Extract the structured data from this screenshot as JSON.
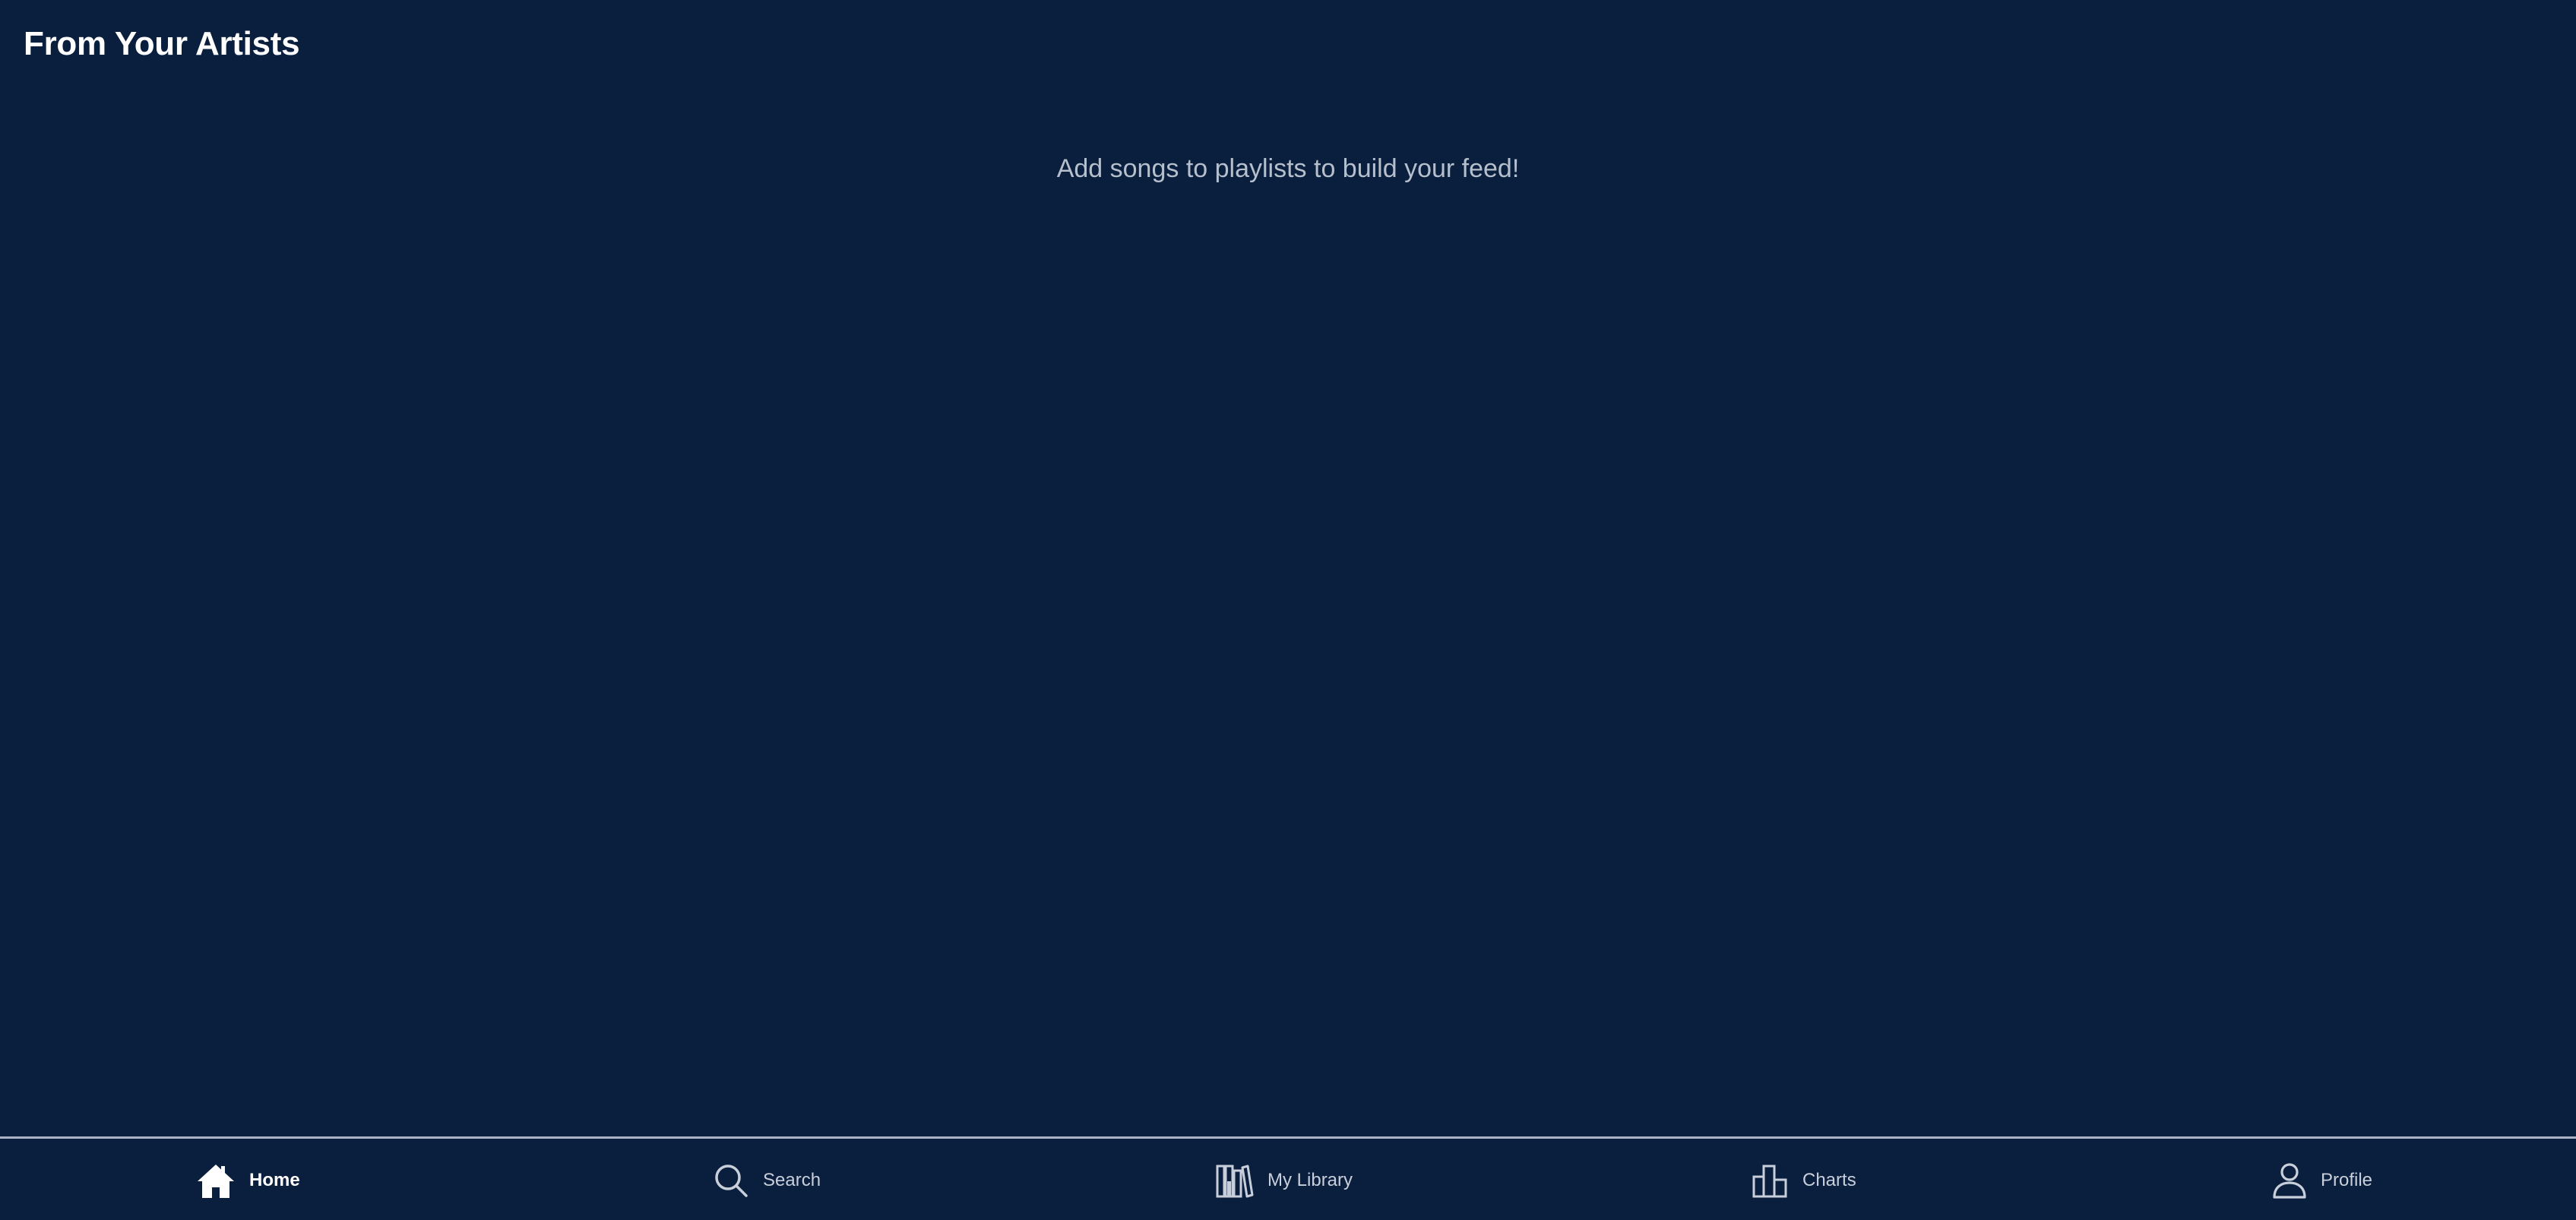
{
  "header": {
    "title": "From Your Artists"
  },
  "main": {
    "empty_message": "Add songs to playlists to build your feed!"
  },
  "nav": {
    "items": [
      {
        "label": "Home",
        "icon": "home-icon",
        "active": true
      },
      {
        "label": "Search",
        "icon": "search-icon",
        "active": false
      },
      {
        "label": "My Library",
        "icon": "library-icon",
        "active": false
      },
      {
        "label": "Charts",
        "icon": "charts-icon",
        "active": false
      },
      {
        "label": "Profile",
        "icon": "profile-icon",
        "active": false
      }
    ]
  },
  "colors": {
    "background": "#0a1e3d",
    "text_primary": "#ffffff",
    "text_muted": "#b6bfcc",
    "divider": "#aab4c4"
  }
}
